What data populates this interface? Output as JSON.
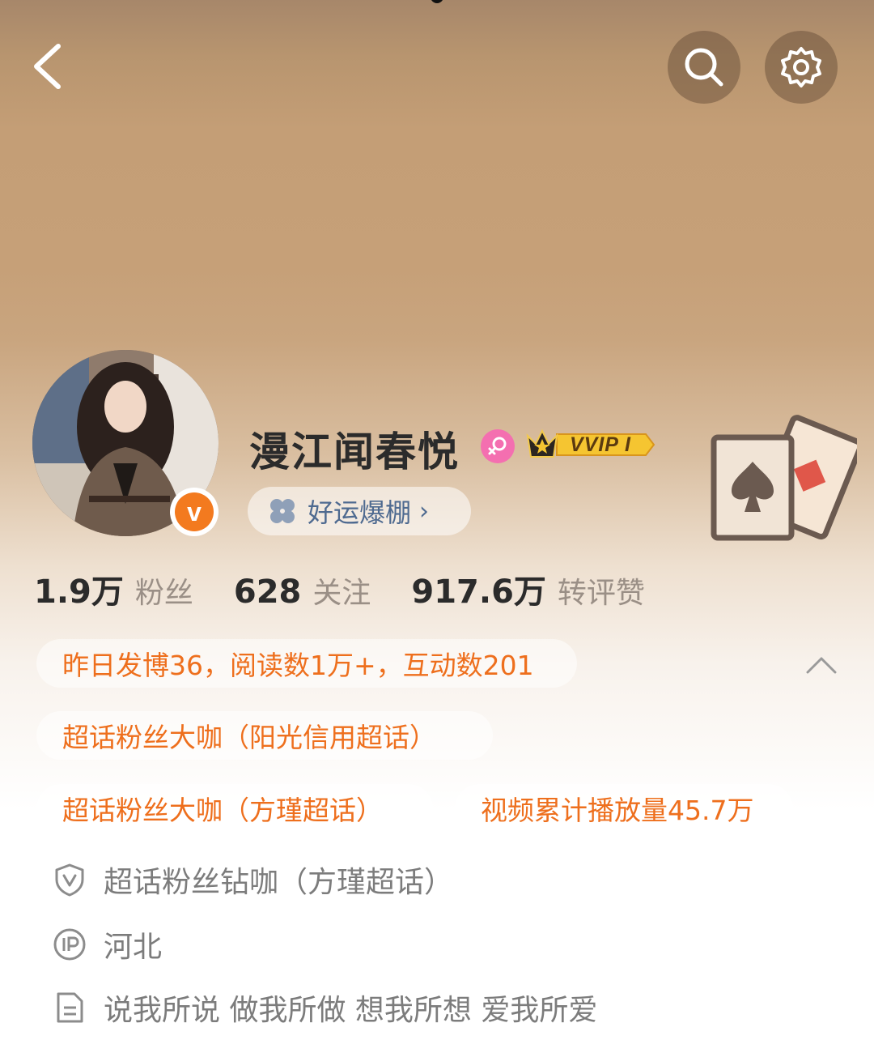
{
  "profile": {
    "username": "漫江闻春悦",
    "vip_label": "VVIP I",
    "luck_badge": "好运爆棚",
    "luck_chevron": "›",
    "colors": {
      "accent_orange": "#ee6f1d",
      "verified_orange": "#f37a1f",
      "gender_pink": "#f46fb0"
    }
  },
  "icons": {
    "back": "back-arrow-icon",
    "search": "search-icon",
    "settings": "gear-icon",
    "verified": "v",
    "cards": "playing-cards-icon"
  },
  "stats": [
    {
      "value": "1.9万",
      "label": "粉丝"
    },
    {
      "value": "628",
      "label": "关注"
    },
    {
      "value": "917.6万",
      "label": "转评赞"
    }
  ],
  "highlights": {
    "yesterday": "昨日发博36，阅读数1万+，互动数201",
    "tag1": "超话粉丝大咖（阳光信用超话）",
    "tag2": "超话粉丝大咖（方瑾超话）",
    "tag3": "视频累计播放量45.7万"
  },
  "info": {
    "supertopic": "超话粉丝钻咖（方瑾超话）",
    "ip_location": "河北",
    "bio": "说我所说 做我所做 想我所想 爱我所爱"
  }
}
